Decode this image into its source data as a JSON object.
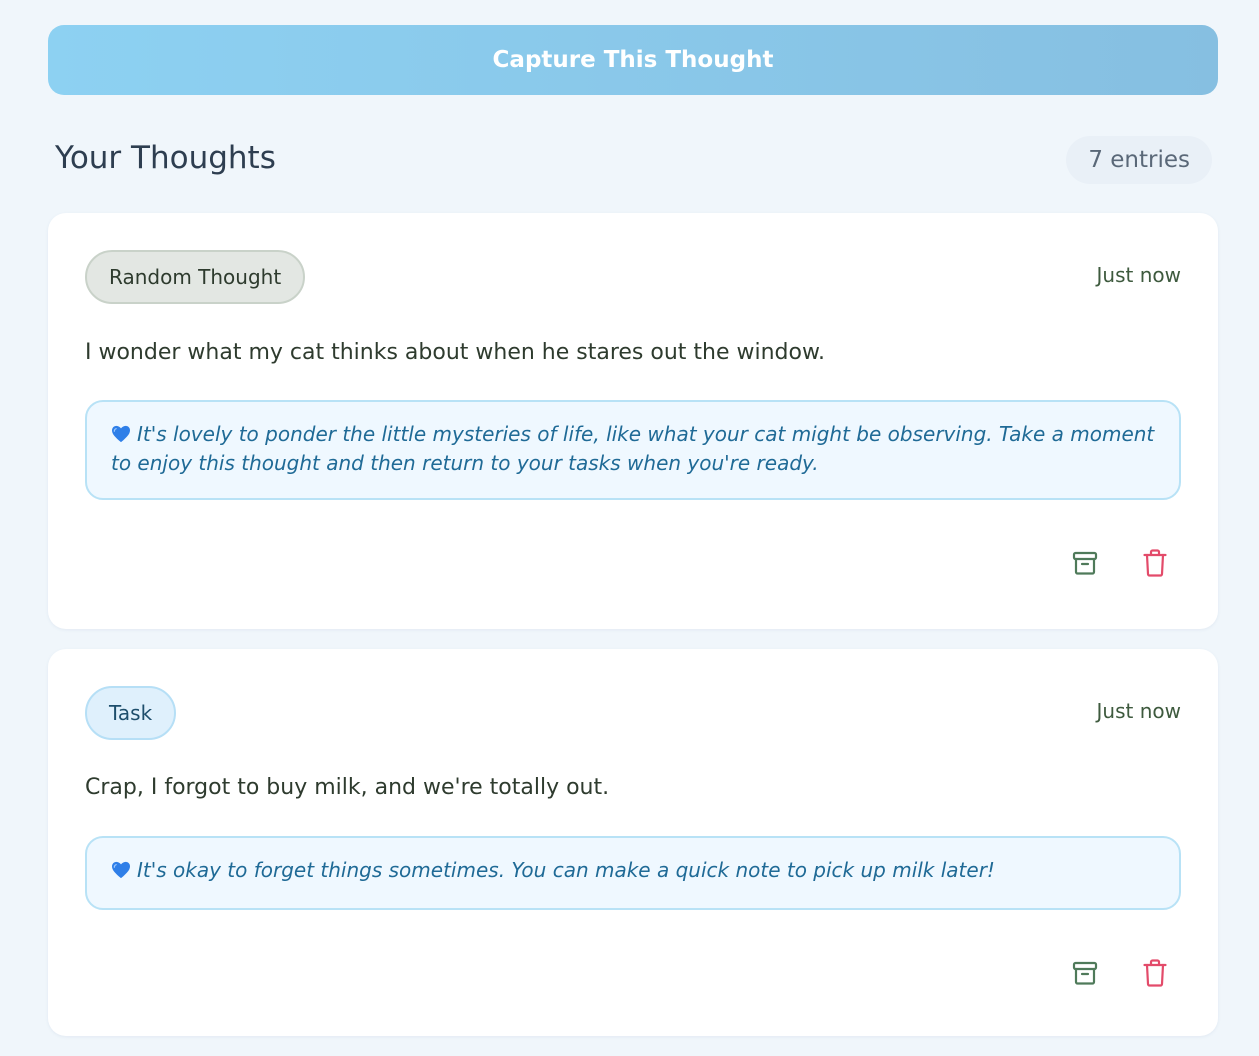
{
  "capture_button": {
    "label": "Capture This Thought"
  },
  "thoughts_section": {
    "title": "Your Thoughts",
    "entry_count": "7 entries"
  },
  "entries": [
    {
      "tag": "Random Thought",
      "timestamp": "Just now",
      "text": "I wonder what my cat thinks about when he stares out the window.",
      "ai_response": "It's lovely to ponder the little mysteries of life, like what your cat might be observing. Take a moment to enjoy this thought and then return to your tasks when you're ready.",
      "ai_icon": "blue-heart-icon",
      "actions": [
        "archive-icon",
        "trash-icon"
      ]
    },
    {
      "tag": "Task",
      "timestamp": "Just now",
      "text": "Crap, I forgot to buy milk, and we're totally out.",
      "ai_response": "It's okay to forget things sometimes. You can make a quick note to pick up milk later!",
      "ai_icon": "blue-heart-icon",
      "actions": [
        "archive-icon",
        "trash-icon"
      ]
    }
  ],
  "colors": {
    "background": "#f0f6fb",
    "capture_gradient_start": "#8dd1f2",
    "capture_gradient_end": "#86bfe1",
    "archive_icon": "#4f7a5a",
    "delete_icon": "#e34b6a",
    "ai_text": "#1f6a96"
  }
}
